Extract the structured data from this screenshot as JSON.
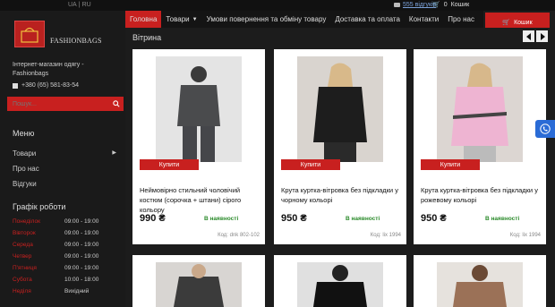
{
  "top": {
    "lang": [
      "UA",
      "RU"
    ],
    "reviews_link": "555 відгуків",
    "cart_label": "Кошик",
    "cart_count": "0"
  },
  "sidebar": {
    "logo_text": "FASHIONBAGS",
    "tagline": "Інтернет-магазин одягу - Fashionbags",
    "phone": "+380 (65) 581-83-54",
    "search_placeholder": "Пошук...",
    "menu_title": "Меню",
    "menu_items": [
      {
        "label": "Товари",
        "has_arrow": true
      },
      {
        "label": "Про нас",
        "has_arrow": false
      },
      {
        "label": "Відгуки",
        "has_arrow": false
      }
    ],
    "schedule_title": "Графік роботи",
    "schedule": [
      {
        "day": "Понеділок",
        "hours": "09:00 - 19:00"
      },
      {
        "day": "Вівторок",
        "hours": "09:00 - 19:00"
      },
      {
        "day": "Середа",
        "hours": "09:00 - 19:00"
      },
      {
        "day": "Четвер",
        "hours": "09:00 - 19:00"
      },
      {
        "day": "П'ятниця",
        "hours": "09:00 - 19:00"
      },
      {
        "day": "Субота",
        "hours": "10:00 - 18:00"
      },
      {
        "day": "Неділя",
        "hours": "Вихідний"
      }
    ]
  },
  "nav": {
    "items": [
      "Головна",
      "Товари",
      "Умови повернення та обміну товару",
      "Доставка та оплата",
      "Контакти",
      "Про нас"
    ],
    "cart_button": "Кошик"
  },
  "main": {
    "section_title": "Вітрина",
    "buy_label": "Купити",
    "products": [
      {
        "title": "Неймовірно стильний чоловічий костюм (сорочка + штани) сірого кольору",
        "price": "990 ₴",
        "availability": "В наявності",
        "code": "Код: dnk 802-102"
      },
      {
        "title": "Крута куртка-вітровка без підкладки у чорному кольорі",
        "price": "950 ₴",
        "availability": "В наявності",
        "code": "Код: lix 1994"
      },
      {
        "title": "Крута куртка-вітровка без підкладки у рожевому кольорі",
        "price": "950 ₴",
        "availability": "В наявності",
        "code": "Код: lix 1994"
      }
    ]
  }
}
